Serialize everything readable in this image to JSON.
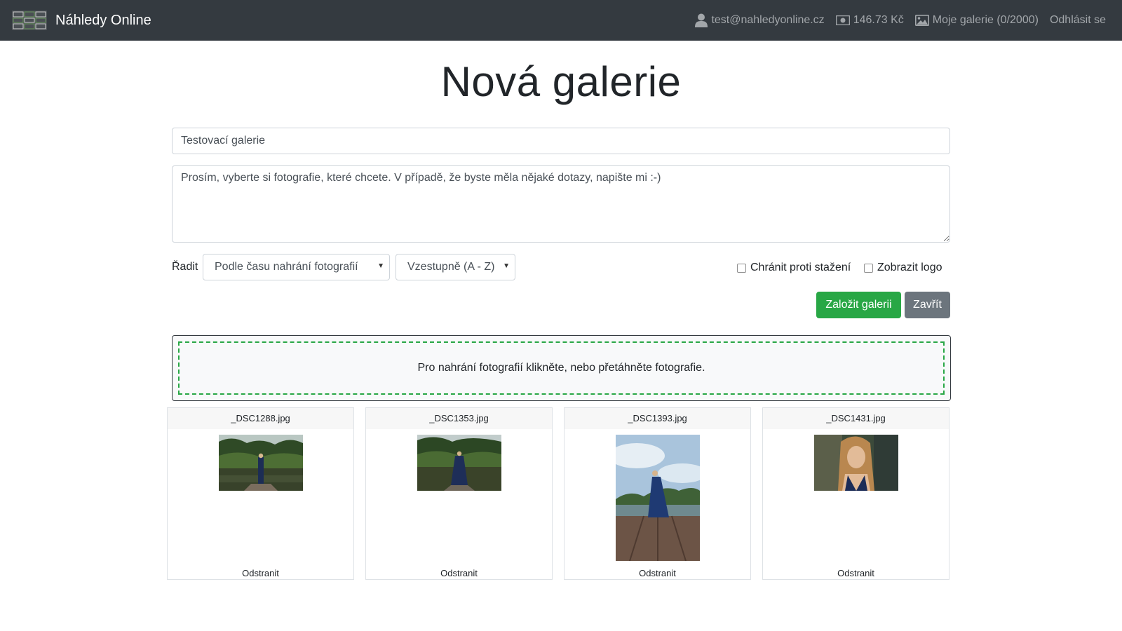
{
  "navbar": {
    "brand": "Náhledy Online",
    "logo_icon": "gallery-grid-logo",
    "user_email": "test@nahledyonline.cz",
    "balance": "146.73 Kč",
    "galleries": "Moje galerie (0/2000)",
    "logout": "Odhlásit se"
  },
  "page": {
    "title": "Nová galerie"
  },
  "form": {
    "gallery_name": "Testovací galerie",
    "description": "Prosím, vyberte si fotografie, které chcete. V případě, že byste měla nějaké dotazy, napište mi :-)",
    "sort_label": "Řadit",
    "sort_by": "Podle času nahrání fotografií",
    "sort_order": "Vzestupně (A - Z)",
    "protect_label": "Chránit proti stažení",
    "protect_checked": false,
    "logo_label": "Zobrazit logo",
    "logo_checked": false,
    "create_button": "Založit galerii",
    "close_button": "Zavřít"
  },
  "dropzone": {
    "text": "Pro nahrání fotografií klikněte, nebo přetáhněte fotografie."
  },
  "photos": [
    {
      "filename": "_DSC1288.jpg",
      "remove": "Odstranit",
      "orientation": "landscape"
    },
    {
      "filename": "_DSC1353.jpg",
      "remove": "Odstranit",
      "orientation": "landscape"
    },
    {
      "filename": "_DSC1393.jpg",
      "remove": "Odstranit",
      "orientation": "portrait"
    },
    {
      "filename": "_DSC1431.jpg",
      "remove": "Odstranit",
      "orientation": "landscape"
    }
  ],
  "colors": {
    "navbar_bg": "#343a40",
    "success": "#28a745",
    "secondary": "#6c757d"
  }
}
